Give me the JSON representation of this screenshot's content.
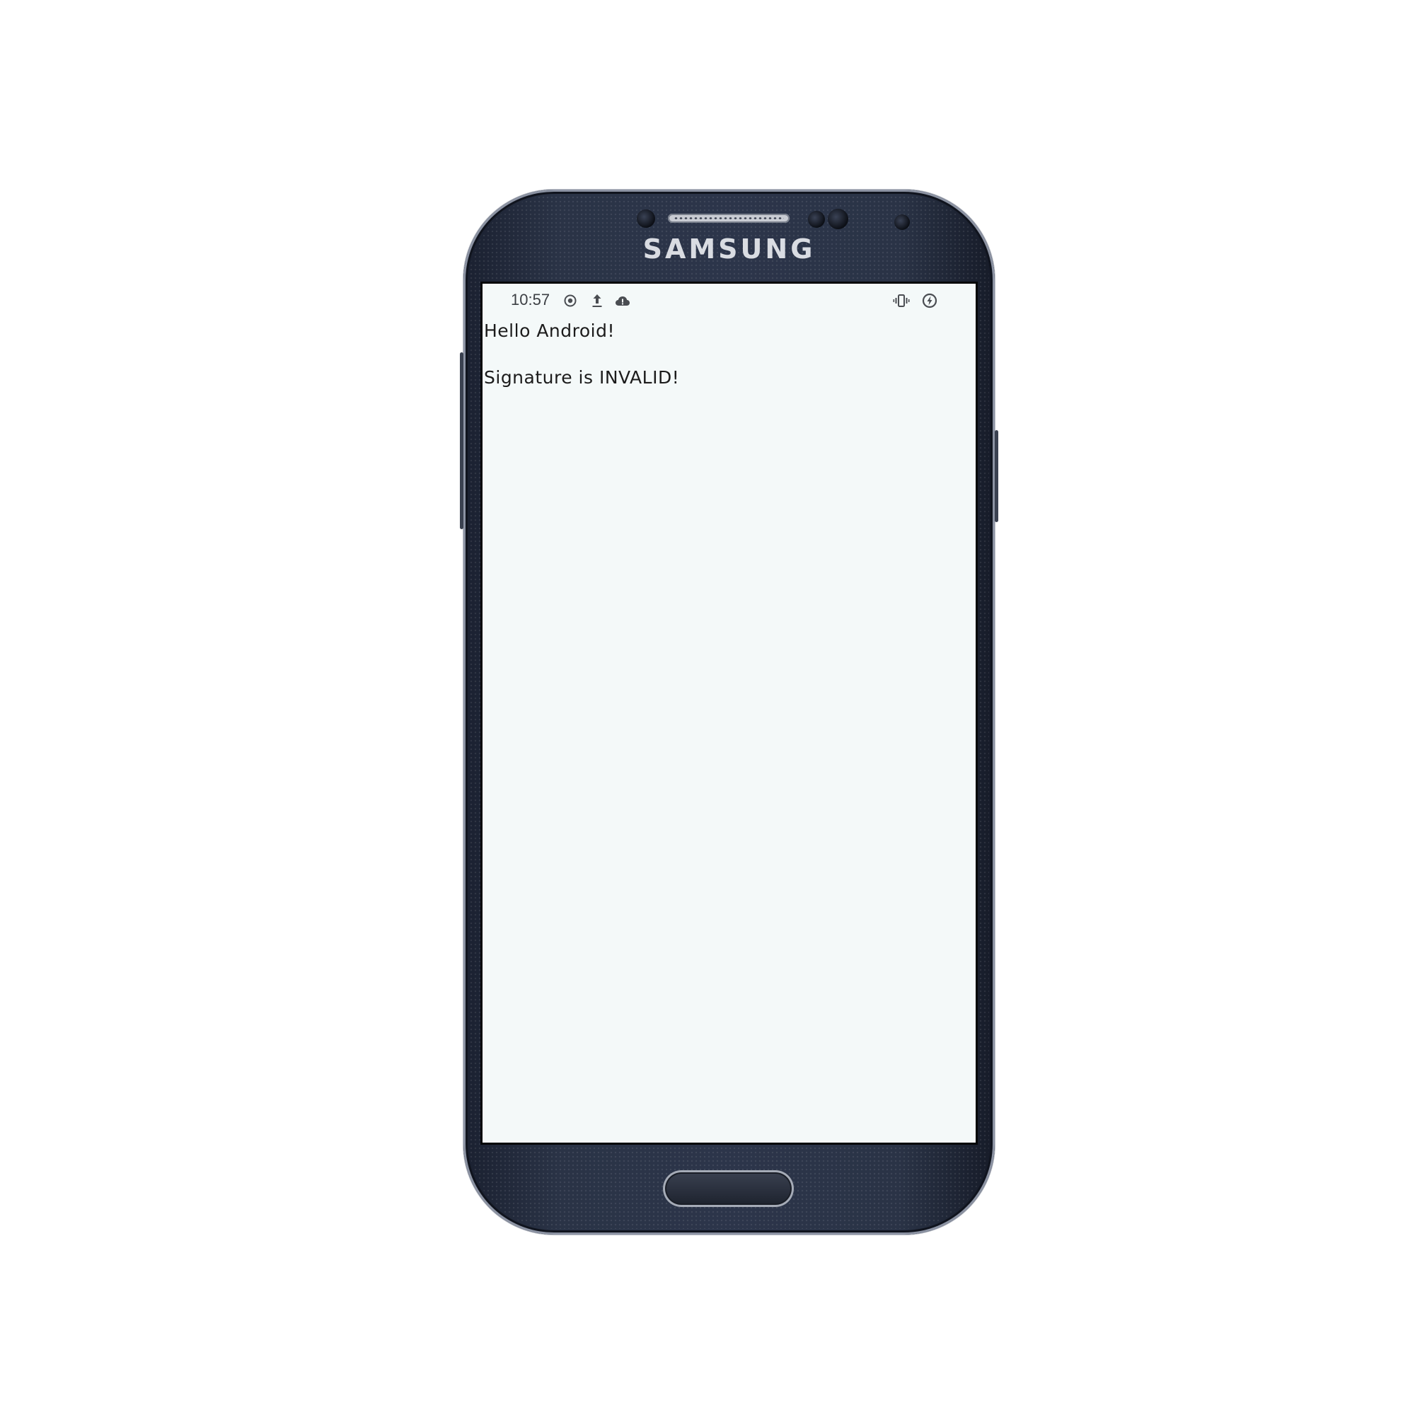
{
  "device": {
    "brand": "SAMSUNG"
  },
  "status_bar": {
    "time": "10:57",
    "left_icons": [
      "location-target-icon",
      "upload-icon",
      "cloud-alert-icon"
    ],
    "right_icons": [
      "vibrate-icon",
      "battery-charging-icon"
    ]
  },
  "app": {
    "lines": [
      "Hello Android!",
      "Signature is INVALID!"
    ]
  },
  "colors": {
    "screen_background": "#f4f9f9",
    "text": "#1c1c1c",
    "status_icons": "#4a4d52"
  }
}
